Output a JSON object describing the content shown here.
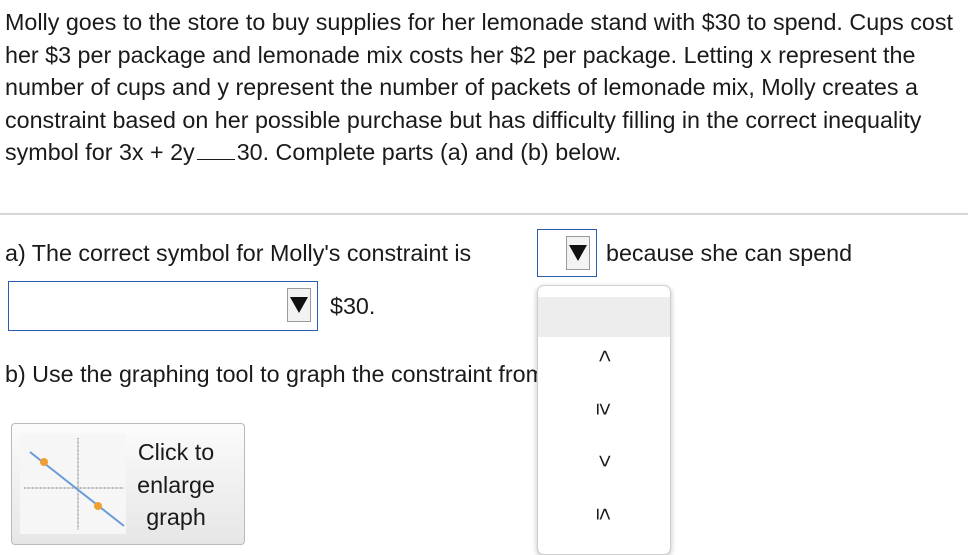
{
  "problem": {
    "text": "Molly goes to the store to buy supplies for her lemonade stand with $30 to spend. Cups cost her $3 per package and lemonade mix costs her $2 per package. Letting x represent the number of cups and y represent the number of packets of lemonade mix, Molly creates a constraint based on her possible purchase but has difficulty filling in the correct inequality symbol for ",
    "expr_left": "3x + 2y",
    "expr_right": "30. Complete parts (a) and (b) below."
  },
  "part_a": {
    "lead": "a) The correct symbol for Molly's constraint is",
    "middle": "because she can spend",
    "end": "$30."
  },
  "part_b": {
    "text": "b) Use the graphing tool to graph the constraint from part (a)."
  },
  "enlarge_button": {
    "label": "Click to enlarge graph"
  },
  "symbol_dropdown": {
    "selected": "",
    "options": [
      "",
      "<",
      "≥",
      ">",
      "≤"
    ]
  },
  "amount_dropdown": {
    "selected": ""
  },
  "colors": {
    "dropdown_border": "#2a5db0",
    "thumbnail_line": "#6b9bd8",
    "thumbnail_points": "#f0a030",
    "divider": "#d6d6d6"
  },
  "icons": [
    "dropdown-arrow-icon",
    "graph-thumbnail-icon"
  ]
}
